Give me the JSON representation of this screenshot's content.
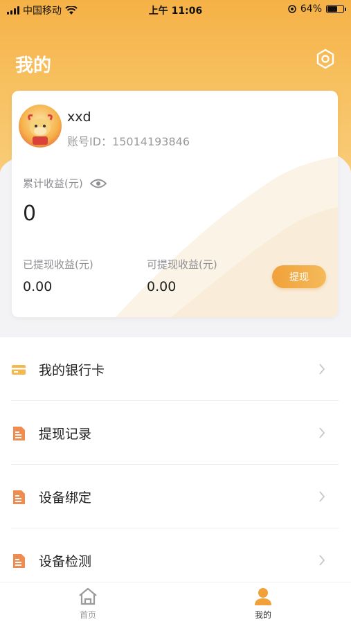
{
  "status_bar": {
    "carrier": "中国移动",
    "time": "上午 11:06",
    "battery": "64%"
  },
  "header": {
    "title": "我的",
    "settings_icon": "settings-hexagon-icon"
  },
  "profile": {
    "username": "xxd",
    "account_id": "账号ID：15014193846"
  },
  "earnings": {
    "cumulative_label": "累计收益(元)",
    "cumulative_value": "0",
    "withdrawn_label": "已提现收益(元)",
    "withdrawn_value": "0.00",
    "available_label": "可提现收益(元)",
    "available_value": "0.00",
    "withdraw_button": "提现"
  },
  "menu": [
    {
      "label": "我的银行卡",
      "icon": "bank-card-icon"
    },
    {
      "label": "提现记录",
      "icon": "document-icon"
    },
    {
      "label": "设备绑定",
      "icon": "document-icon"
    },
    {
      "label": "设备检测",
      "icon": "document-icon"
    }
  ],
  "tabbar": [
    {
      "label": "首页",
      "icon": "home-icon",
      "active": false
    },
    {
      "label": "我的",
      "icon": "user-icon",
      "active": true
    }
  ],
  "colors": {
    "accent": "#f2a93b",
    "header_top": "#f5b146",
    "inactive": "#999999"
  }
}
